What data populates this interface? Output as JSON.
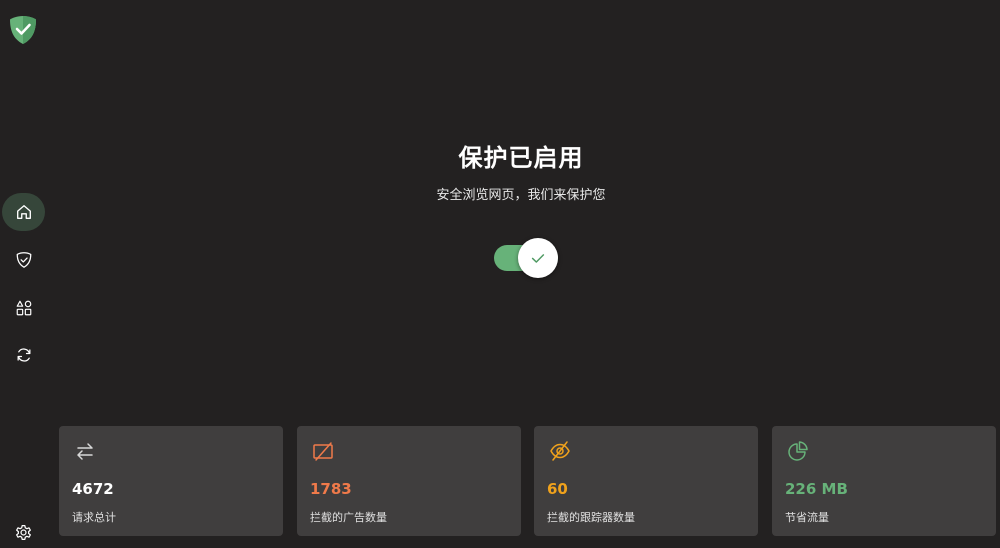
{
  "hero": {
    "title": "保护已启用",
    "subtitle": "安全浏览网页，我们来保护您",
    "toggle_on": true
  },
  "sidebar": {
    "items": [
      {
        "icon": "home-icon",
        "active": true
      },
      {
        "icon": "shield-check-icon",
        "active": false
      },
      {
        "icon": "apps-grid-icon",
        "active": false
      },
      {
        "icon": "sync-icon",
        "active": false
      }
    ],
    "footer_icon": "settings-gear-icon"
  },
  "stats": [
    {
      "icon": "requests-arrows-icon",
      "value": "4672",
      "label": "请求总计",
      "color": "#ffffff"
    },
    {
      "icon": "ad-blocked-icon",
      "value": "1783",
      "label": "拦截的广告数量",
      "color": "#f07a4a"
    },
    {
      "icon": "tracker-blocked-eye-icon",
      "value": "60",
      "label": "拦截的跟踪器数量",
      "color": "#f0a21c"
    },
    {
      "icon": "traffic-pie-icon",
      "value": "226 MB",
      "label": "节省流量",
      "color": "#67b279"
    }
  ],
  "colors": {
    "background": "#232121",
    "card": "#403e3e",
    "accent_green": "#67b279",
    "active_nav": "#36463a"
  }
}
